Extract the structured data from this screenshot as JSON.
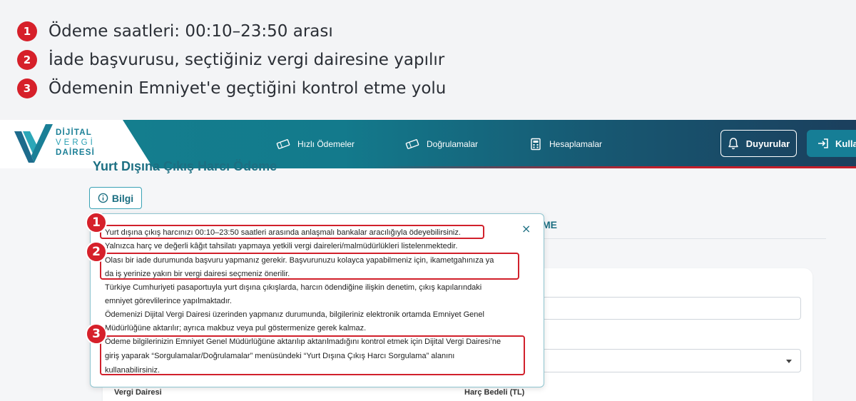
{
  "annotations": [
    {
      "number": "1",
      "text": "Ödeme saatleri: 00:10–23:50 arası"
    },
    {
      "number": "2",
      "text": "İade başvurusu, seçtiğiniz vergi dairesine yapılır"
    },
    {
      "number": "3",
      "text": "Ödemenin Emniyet'e geçtiğini kontrol etme yolu"
    }
  ],
  "header": {
    "logo": {
      "line1": "DİJİTAL",
      "line2": "VERGİ",
      "line3": "DAİRESİ"
    },
    "nav": [
      {
        "label": "Hızlı Ödemeler",
        "icon": "ticket-icon"
      },
      {
        "label": "Doğrulamalar",
        "icon": "ticket-icon"
      },
      {
        "label": "Hesaplamalar",
        "icon": "calculator-icon"
      }
    ],
    "announcements_label": "Duyurular",
    "user_label": "Kullan"
  },
  "page": {
    "title_partial": "Yurt Dışına Çıkış Harcı Ödeme",
    "info_button": "Bilgi",
    "tab_partial": "ME",
    "table_headers": [
      "Vergi Dairesi",
      "Harç Bedeli (TL)"
    ]
  },
  "popover": {
    "close": "×",
    "lines": [
      "Yurt dışına çıkış harcınızı 00:10–23:50 saatleri arasında anlaşmalı bankalar aracılığıyla ödeyebilirsiniz.",
      "Yalnızca harç ve değerli kâğıt tahsilatı yapmaya yetkili vergi daireleri/malmüdürlükleri listelenmektedir.",
      "Olası bir iade durumunda başvuru yapmanız gerekir. Başvurunuzu kolayca yapabilmeniz için, ikametgahınıza ya",
      "da iş yerinize yakın bir vergi dairesi seçmeniz önerilir.",
      "Türkiye Cumhuriyeti pasaportuyla yurt dışına çıkışlarda, harcın ödendiğine ilişkin denetim, çıkış kapılarındaki",
      "emniyet görevlilerince yapılmaktadır.",
      "Ödemenizi Dijital Vergi Dairesi üzerinden yapmanız durumunda, bilgileriniz elektronik ortamda Emniyet Genel",
      "Müdürlüğüne aktarılır; ayrıca makbuz veya pul göstermenize gerek kalmaz.",
      "Ödeme bilgilerinizin Emniyet Genel Müdürlüğüne aktarılıp aktarılmadığını kontrol etmek için Dijital Vergi Dairesi’ne",
      "giriş yaparak “Sorgulamalar/Doğrulamalar” menüsündeki “Yurt Dışına Çıkış Harcı Sorgulama” alanını",
      "kullanabilirsiniz."
    ],
    "markers": [
      "1",
      "2",
      "3"
    ]
  },
  "colors": {
    "accent": "#d6202a",
    "brand": "#167e96",
    "header_dark": "#1b3f5d"
  }
}
